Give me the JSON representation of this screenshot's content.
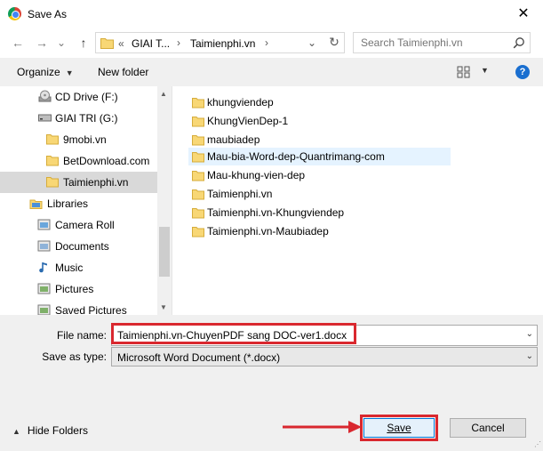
{
  "window": {
    "title": "Save As",
    "close_glyph": "✕",
    "title_icon": "chrome-icon"
  },
  "nav": {
    "back_glyph": "←",
    "forward_glyph": "→",
    "recent_glyph": "⌄",
    "up_glyph": "↑",
    "address": {
      "overflow": "«",
      "segments": [
        "GIAI T...",
        "Taimienphi.vn"
      ],
      "chevron": "›"
    },
    "refresh_glyph": "↻",
    "search": {
      "placeholder": "Search Taimienphi.vn"
    }
  },
  "toolbar": {
    "organize_label": "Organize",
    "new_folder_label": "New folder",
    "help_glyph": "?",
    "caret": "▼"
  },
  "sidebar": {
    "items": [
      {
        "label": "CD Drive (F:)",
        "icon": "cd-drive-icon"
      },
      {
        "label": "GIAI TRI (G:)",
        "icon": "drive-icon"
      },
      {
        "label": "9mobi.vn",
        "icon": "folder-icon"
      },
      {
        "label": "BetDownload.com",
        "icon": "folder-icon"
      },
      {
        "label": "Taimienphi.vn",
        "icon": "folder-icon",
        "selected": true
      },
      {
        "label": "Libraries",
        "icon": "libraries-icon"
      },
      {
        "label": "Camera Roll",
        "icon": "library-icon"
      },
      {
        "label": "Documents",
        "icon": "library-icon"
      },
      {
        "label": "Music",
        "icon": "music-icon"
      },
      {
        "label": "Pictures",
        "icon": "library-icon"
      },
      {
        "label": "Saved Pictures",
        "icon": "library-icon"
      }
    ],
    "scroll_up_glyph": "▲",
    "scroll_down_glyph": "▼"
  },
  "files": [
    {
      "name": "khungviendep"
    },
    {
      "name": "KhungVienDep-1"
    },
    {
      "name": "maubiadep"
    },
    {
      "name": "Mau-bia-Word-dep-Quantrimang-com",
      "hover": true
    },
    {
      "name": "Mau-khung-vien-dep"
    },
    {
      "name": "Taimienphi.vn"
    },
    {
      "name": "Taimienphi.vn-Khungviendep"
    },
    {
      "name": "Taimienphi.vn-Maubiadep"
    }
  ],
  "form": {
    "file_name_label": "File name:",
    "file_name_value": "Taimienphi.vn-ChuyenPDF sang DOC-ver1.docx",
    "save_type_label": "Save as type:",
    "save_type_value": "Microsoft Word Document (*.docx)",
    "dropdown_glyph": "⌄"
  },
  "footer": {
    "hide_folders_label": "Hide Folders",
    "hide_caret": "▲",
    "save_label": "Save",
    "cancel_label": "Cancel",
    "grip": "⋰"
  },
  "colors": {
    "accent": "#0078d7",
    "highlight_box": "#d9282f",
    "selected_row": "#d9d9d9",
    "hover_row": "#e5f3ff"
  }
}
